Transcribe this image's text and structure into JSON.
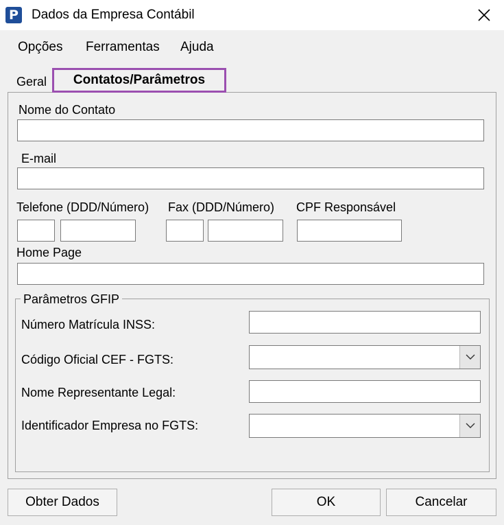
{
  "window": {
    "title": "Dados da Empresa Contábil",
    "icon_letter": "P",
    "close_icon": "close-x-icon"
  },
  "menu": [
    {
      "label": "Opções"
    },
    {
      "label": "Ferramentas"
    },
    {
      "label": "Ajuda"
    }
  ],
  "tabs": [
    {
      "label": "Geral",
      "active": false
    },
    {
      "label": "Contatos/Parâmetros",
      "active": true
    }
  ],
  "form": {
    "nome_contato": {
      "label": "Nome do Contato",
      "value": ""
    },
    "email": {
      "label": "E-mail",
      "value": ""
    },
    "telefone": {
      "label": "Telefone (DDD/Número)",
      "ddd": "",
      "numero": ""
    },
    "fax": {
      "label": "Fax (DDD/Número)",
      "ddd": "",
      "numero": ""
    },
    "cpf": {
      "label": "CPF Responsável",
      "value": ""
    },
    "home_page": {
      "label": "Home Page",
      "value": ""
    }
  },
  "gfip": {
    "legend": "Parâmetros GFIP",
    "matricula_inss": {
      "label": "Número Matrícula INSS:",
      "value": ""
    },
    "codigo_cef": {
      "label": "Código Oficial CEF - FGTS:",
      "value": ""
    },
    "representante_legal": {
      "label": "Nome Representante Legal:",
      "value": ""
    },
    "identificador_fgts": {
      "label": "Identificador Empresa no FGTS:",
      "value": ""
    }
  },
  "buttons": {
    "obter_dados": "Obter Dados",
    "ok": "OK",
    "cancelar": "Cancelar"
  },
  "colors": {
    "active_tab_highlight": "#9b4fb0",
    "app_icon": "#1f4e99"
  }
}
